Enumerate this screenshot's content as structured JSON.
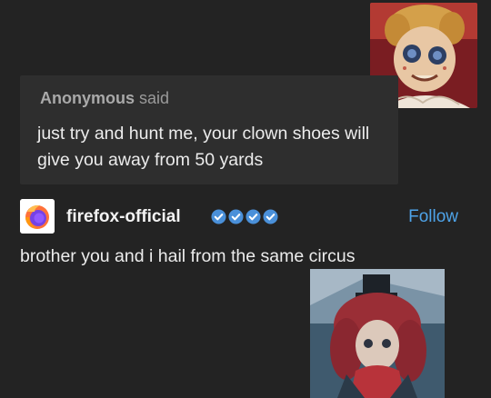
{
  "ask": {
    "asker_name": "Anonymous",
    "said_label": "said",
    "question": "just try and hunt me, your clown shoes will give you away from 50 yards"
  },
  "answer": {
    "blog_name": "firefox-official",
    "follow_label": "Follow",
    "text": "brother you and i hail from the same circus"
  },
  "colors": {
    "background": "#232323",
    "ask_box": "#2e2e2e",
    "follow_link": "#4ea3e8",
    "badge": "#4a90d9"
  },
  "icons": {
    "asker_avatar": "clown-portrait-avatar",
    "blog_avatar": "firefox-logo-icon",
    "badges": [
      "verified-check-icon",
      "verified-check-icon",
      "verified-check-icon",
      "verified-check-icon"
    ],
    "answer_image": "character-portrait-image"
  }
}
